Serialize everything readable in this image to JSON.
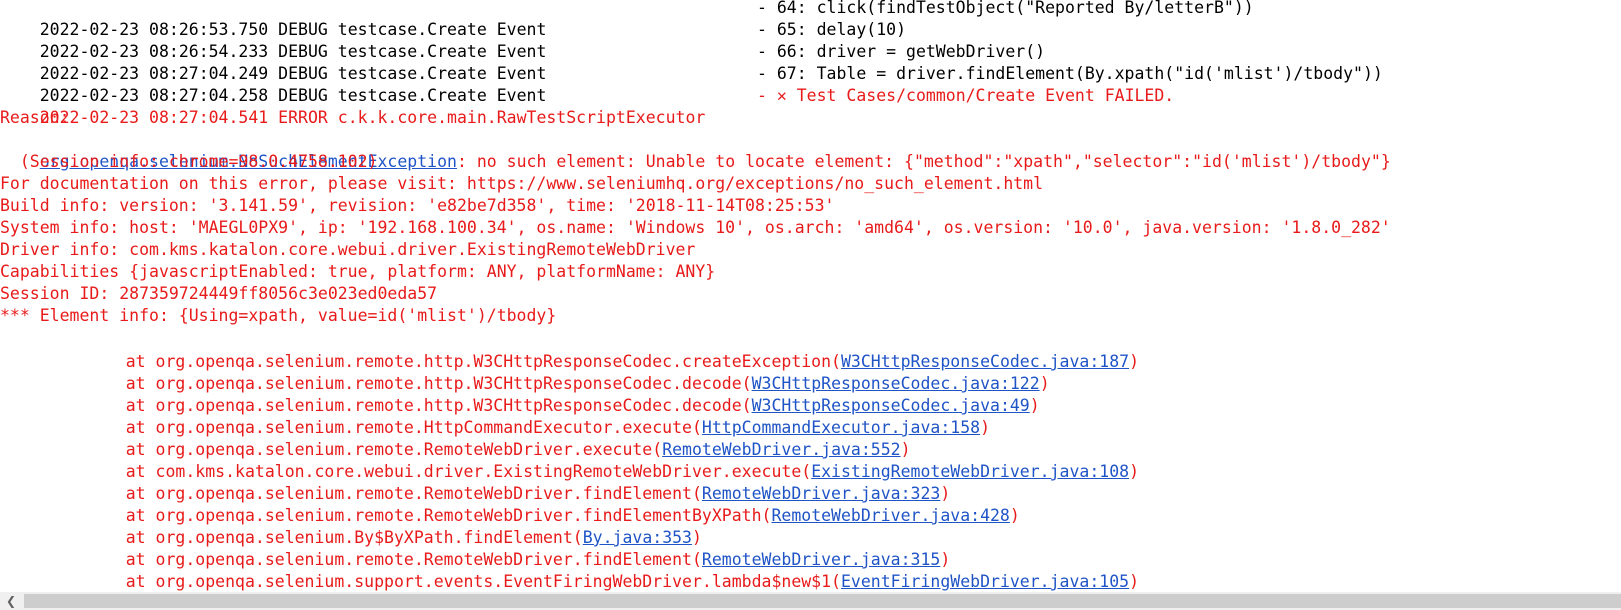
{
  "debug_lines": [
    {
      "prefix": "2022-02-23 08:26:53.750 DEBUG testcase.Create Event",
      "message": "- 64: click(findTestObject(\"Reported By/letterB\"))"
    },
    {
      "prefix": "2022-02-23 08:26:54.233 DEBUG testcase.Create Event",
      "message": "- 65: delay(10)"
    },
    {
      "prefix": "2022-02-23 08:27:04.249 DEBUG testcase.Create Event",
      "message": "- 66: driver = getWebDriver()"
    },
    {
      "prefix": "2022-02-23 08:27:04.258 DEBUG testcase.Create Event",
      "message": "- 67: Table = driver.findElement(By.xpath(\"id('mlist')/tbody\"))"
    }
  ],
  "error_line": {
    "prefix": "2022-02-23 08:27:04.541 ERROR c.k.k.core.main.RawTestScriptExecutor",
    "dash": "- ",
    "fail_icon": "✕",
    "message": " Test Cases/common/Create Event FAILED."
  },
  "reason_label": "Reason:",
  "exception": {
    "class_link": "org.openqa.selenium.NoSuchElementException",
    "message": ": no such element: Unable to locate element: {\"method\":\"xpath\",\"selector\":\"id('mlist')/tbody\"}"
  },
  "details": [
    "  (Session info: chrome=98.0.4758.102)",
    "For documentation on this error, please visit: https://www.seleniumhq.org/exceptions/no_such_element.html",
    "Build info: version: '3.141.59', revision: 'e82be7d358', time: '2018-11-14T08:25:53'",
    "System info: host: 'MAEGL0PX9', ip: '192.168.100.34', os.name: 'Windows 10', os.arch: 'amd64', os.version: '10.0', java.version: '1.8.0_282'",
    "Driver info: com.kms.katalon.core.webui.driver.ExistingRemoteWebDriver",
    "Capabilities {javascriptEnabled: true, platform: ANY, platformName: ANY}",
    "Session ID: 287359724449ff8056c3e023ed0eda57",
    "*** Element info: {Using=xpath, value=id('mlist')/tbody}"
  ],
  "stack": [
    {
      "method": "at org.openqa.selenium.remote.http.W3CHttpResponseCodec.createException(",
      "link": "W3CHttpResponseCodec.java:187",
      "close": ")"
    },
    {
      "method": "at org.openqa.selenium.remote.http.W3CHttpResponseCodec.decode(",
      "link": "W3CHttpResponseCodec.java:122",
      "close": ")"
    },
    {
      "method": "at org.openqa.selenium.remote.http.W3CHttpResponseCodec.decode(",
      "link": "W3CHttpResponseCodec.java:49",
      "close": ")"
    },
    {
      "method": "at org.openqa.selenium.remote.HttpCommandExecutor.execute(",
      "link": "HttpCommandExecutor.java:158",
      "close": ")"
    },
    {
      "method": "at org.openqa.selenium.remote.RemoteWebDriver.execute(",
      "link": "RemoteWebDriver.java:552",
      "close": ")"
    },
    {
      "method": "at com.kms.katalon.core.webui.driver.ExistingRemoteWebDriver.execute(",
      "link": "ExistingRemoteWebDriver.java:108",
      "close": ")"
    },
    {
      "method": "at org.openqa.selenium.remote.RemoteWebDriver.findElement(",
      "link": "RemoteWebDriver.java:323",
      "close": ")"
    },
    {
      "method": "at org.openqa.selenium.remote.RemoteWebDriver.findElementByXPath(",
      "link": "RemoteWebDriver.java:428",
      "close": ")"
    },
    {
      "method": "at org.openqa.selenium.By$ByXPath.findElement(",
      "link": "By.java:353",
      "close": ")"
    },
    {
      "method": "at org.openqa.selenium.remote.RemoteWebDriver.findElement(",
      "link": "RemoteWebDriver.java:315",
      "close": ")"
    },
    {
      "method": "at org.openqa.selenium.support.events.EventFiringWebDriver.lambda$new$1(",
      "link": "EventFiringWebDriver.java:105",
      "close": ")"
    }
  ],
  "scrollbar": {
    "left_arrow": "❮"
  },
  "colors": {
    "debug_text": "#000000",
    "error_text": "#e81a1a",
    "link": "#1f54c7"
  }
}
